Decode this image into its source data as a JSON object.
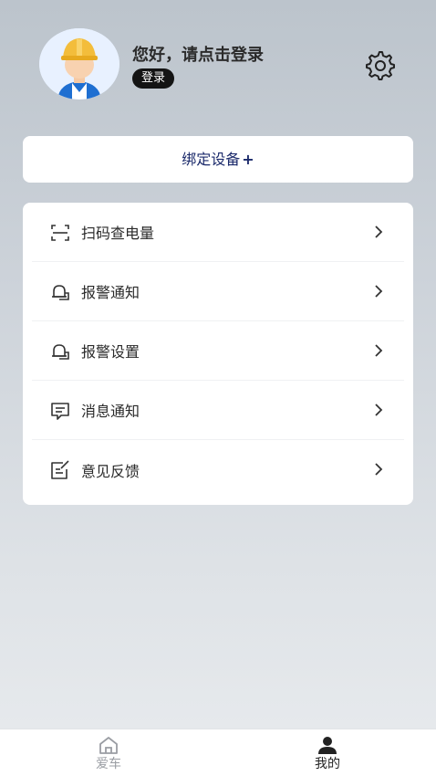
{
  "header": {
    "greeting": "您好，请点击登录",
    "login_label": "登录"
  },
  "bind_device": {
    "label": "绑定设备",
    "plus": "+"
  },
  "menu": [
    {
      "label": "扫码查电量",
      "icon": "scan-icon"
    },
    {
      "label": "报警通知",
      "icon": "alarm-bell-icon"
    },
    {
      "label": "报警设置",
      "icon": "alarm-settings-icon"
    },
    {
      "label": "消息通知",
      "icon": "message-icon"
    },
    {
      "label": "意见反馈",
      "icon": "feedback-icon"
    }
  ],
  "tabbar": {
    "tabs": [
      {
        "label": "爱车",
        "icon": "home-icon",
        "active": false
      },
      {
        "label": "我的",
        "icon": "person-icon",
        "active": true
      }
    ]
  },
  "colors": {
    "accent_text": "#1b2a6b",
    "active_tab": "#222222",
    "inactive_tab": "#9a9da3"
  }
}
